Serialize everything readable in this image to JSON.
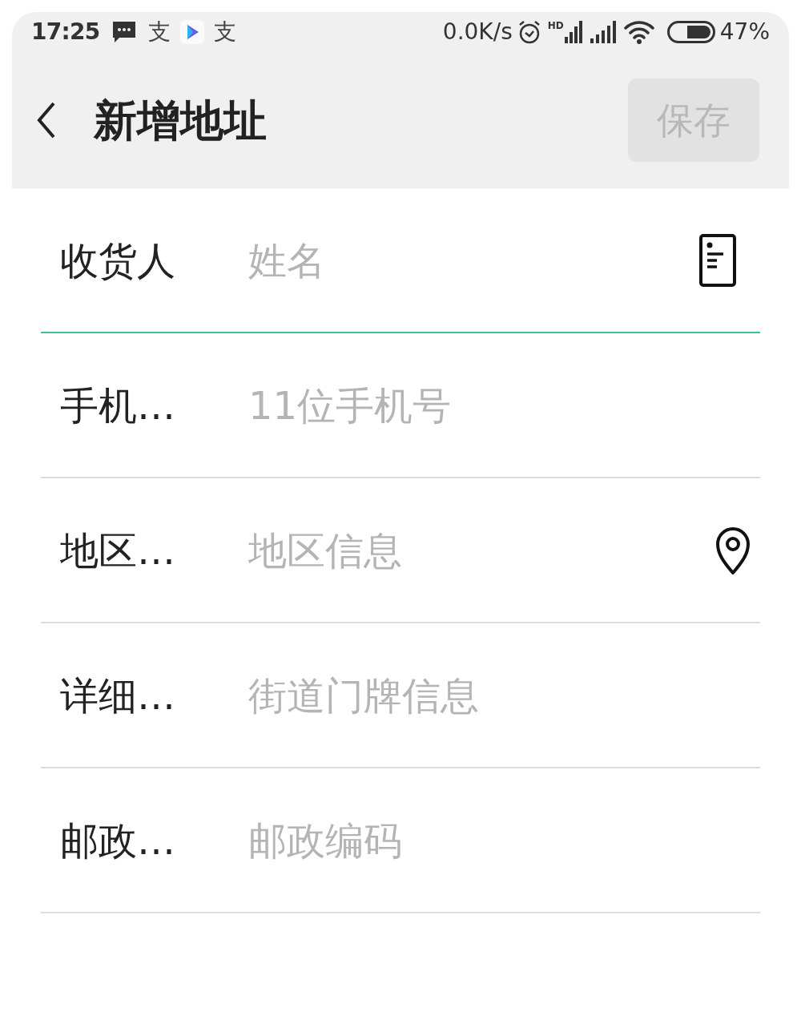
{
  "status_bar": {
    "time": "17:25",
    "notification_glyphs": [
      "支",
      "支"
    ],
    "network_speed": "0.0K/s",
    "signal_label": "HD",
    "battery": "47%"
  },
  "header": {
    "title": "新增地址",
    "save_button": {
      "label": "保存",
      "disabled": true
    }
  },
  "fields": [
    {
      "label": "收货人",
      "placeholder": "姓名",
      "focused": true,
      "kind": "contact"
    },
    {
      "label": "手机…",
      "placeholder": "11位手机号",
      "focused": false,
      "kind": "plain"
    },
    {
      "label": "地区…",
      "placeholder": "地区信息",
      "focused": false,
      "kind": "location"
    },
    {
      "label": "详细…",
      "placeholder": "街道门牌信息",
      "focused": false,
      "kind": "plain"
    },
    {
      "label": "邮政…",
      "placeholder": "邮政编码",
      "focused": false,
      "kind": "plain"
    }
  ]
}
